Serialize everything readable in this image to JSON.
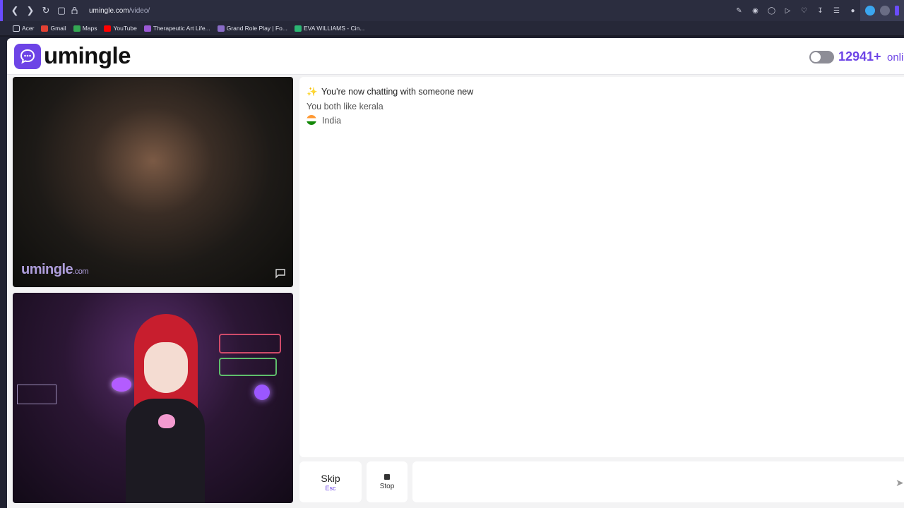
{
  "browser": {
    "url_host": "umingle.com",
    "url_path": "/video/",
    "bookmarks": [
      {
        "label": "Acer",
        "color": "#cfd2e0"
      },
      {
        "label": "Gmail",
        "color": "#e34133"
      },
      {
        "label": "Maps",
        "color": "#34a853"
      },
      {
        "label": "YouTube",
        "color": "#ff0000"
      },
      {
        "label": "Therapeutic Art Life...",
        "color": "#9b59d6"
      },
      {
        "label": "Grand Role Play | Fo...",
        "color": "#8a6cc8"
      },
      {
        "label": "EVA WILLIAMS - Cin...",
        "color": "#2bb673"
      }
    ]
  },
  "header": {
    "logo_text": "umingle",
    "online_count": "12941+",
    "online_label": "onli"
  },
  "video": {
    "watermark": "umingle",
    "watermark_suffix": ".com"
  },
  "chat": {
    "title": "You're now chatting with someone new",
    "common_interest": "You both like kerala",
    "country": "India"
  },
  "controls": {
    "skip_label": "Skip",
    "skip_hint": "Esc",
    "stop_label": "Stop",
    "message_placeholder": ""
  },
  "colors": {
    "brand": "#6d44e6"
  }
}
